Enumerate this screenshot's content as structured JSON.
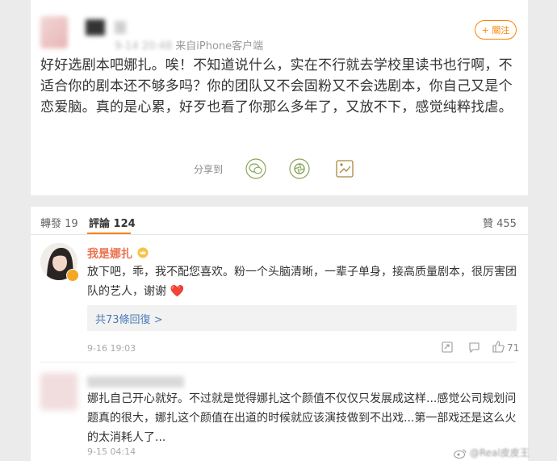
{
  "post": {
    "meta_source": "来自iPhone客户端",
    "meta_time": "9-14 20:48",
    "follow_label": "+ 關注",
    "text": "好好选剧本吧娜扎。唉！不知道说什么，实在不行就去学校里读书也行啊，不适合你的剧本还不够多吗？你的团队又不会固粉又不会选剧本，你自己又是个恋爱脑。真的是心累，好歹也看了你那么多年了，又放不下，感觉纯粹找虐。",
    "share_label": "分享到",
    "share_icons": [
      "wechat-icon",
      "moments-icon",
      "weibo-share-icon"
    ]
  },
  "tabs": {
    "repost": "轉發 19",
    "comments": "評論 124",
    "likes": "贊 455"
  },
  "comments": [
    {
      "name": "我是娜扎",
      "badge": "crown-badge-icon",
      "text": "放下吧，乖，我不配您喜欢。粉一个头脑清晰，一辈子单身，接高质量剧本，很厉害团队的艺人，谢谢",
      "emoji": "❤️",
      "replies": "共73條回復 >",
      "time": "9-16 19:03",
      "likes": "71"
    },
    {
      "text": "娜扎自己开心就好。不过就是觉得娜扎这个颜值不仅仅只发展成这样...感觉公司规划问题真的很大，娜扎这个颜值在出道的时候就应该演技做到不出戏...第一部戏还是这么火的太消耗人了...",
      "time": "9-15 04:14"
    }
  ],
  "watermark": {
    "prefix": "微博",
    "handle": "@Real皮皮王"
  },
  "colors": {
    "accent": "#ff8200",
    "name": "#eb7350",
    "link": "#4a7bb5",
    "heart": "#e0245e"
  }
}
